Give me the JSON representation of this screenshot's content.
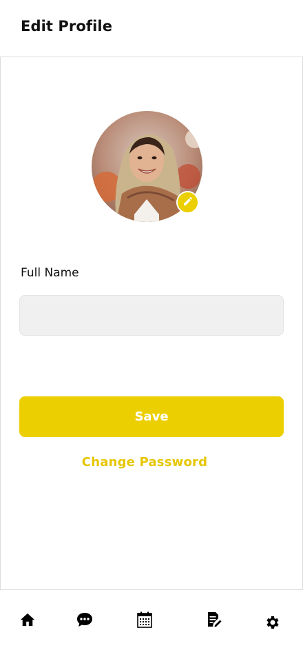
{
  "header": {
    "title": "Edit Profile"
  },
  "profile": {
    "avatar_icon": "profile-photo",
    "edit_icon": "pencil-icon",
    "accent_color": "#eccf00"
  },
  "form": {
    "full_name_label": "Full Name",
    "full_name_value": "",
    "full_name_placeholder": ""
  },
  "actions": {
    "save_label": "Save",
    "change_password_label": "Change Password"
  },
  "bottom_nav": {
    "items": [
      {
        "icon": "home-icon"
      },
      {
        "icon": "chat-icon"
      },
      {
        "icon": "calendar-icon"
      },
      {
        "icon": "notes-edit-icon"
      },
      {
        "icon": "gear-icon"
      }
    ]
  }
}
